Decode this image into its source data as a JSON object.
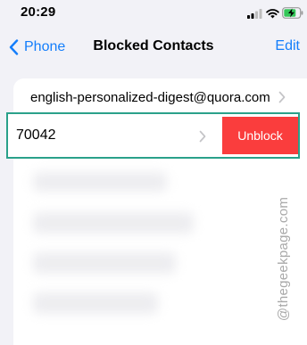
{
  "status_bar": {
    "time": "20:29"
  },
  "nav": {
    "back_label": "Phone",
    "title": "Blocked Contacts",
    "edit_label": "Edit"
  },
  "contacts": [
    {
      "label": "english-personalized-digest@quora.com"
    },
    {
      "label": "70042",
      "swipe_action": "Unblock"
    }
  ],
  "watermark": "@thegeekpage.com",
  "colors": {
    "accent": "#147efb",
    "destructive": "#fa3d3d",
    "highlight_border": "#2aa18a",
    "background": "#f2f2f7"
  }
}
